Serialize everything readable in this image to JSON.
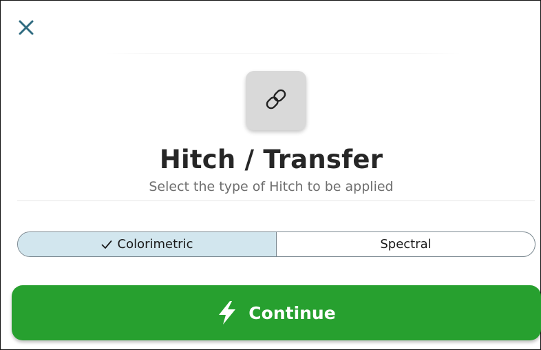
{
  "dialog": {
    "close_icon": "close-icon",
    "header_icon": "link-icon",
    "title": "Hitch / Transfer",
    "subtitle": "Select the type of Hitch to be applied"
  },
  "type_selector": {
    "options": [
      {
        "label": "Colorimetric",
        "selected": true,
        "icon": "checkmark-icon"
      },
      {
        "label": "Spectral",
        "selected": false
      }
    ]
  },
  "continue_button": {
    "label": "Continue",
    "icon": "lightning-bolt-icon"
  },
  "colors": {
    "accent_close": "#2f6b80",
    "continue_bg": "#27a02f",
    "selected_segment_bg": "#d2e6ee",
    "icon_tile_bg": "#d9d9d9"
  }
}
